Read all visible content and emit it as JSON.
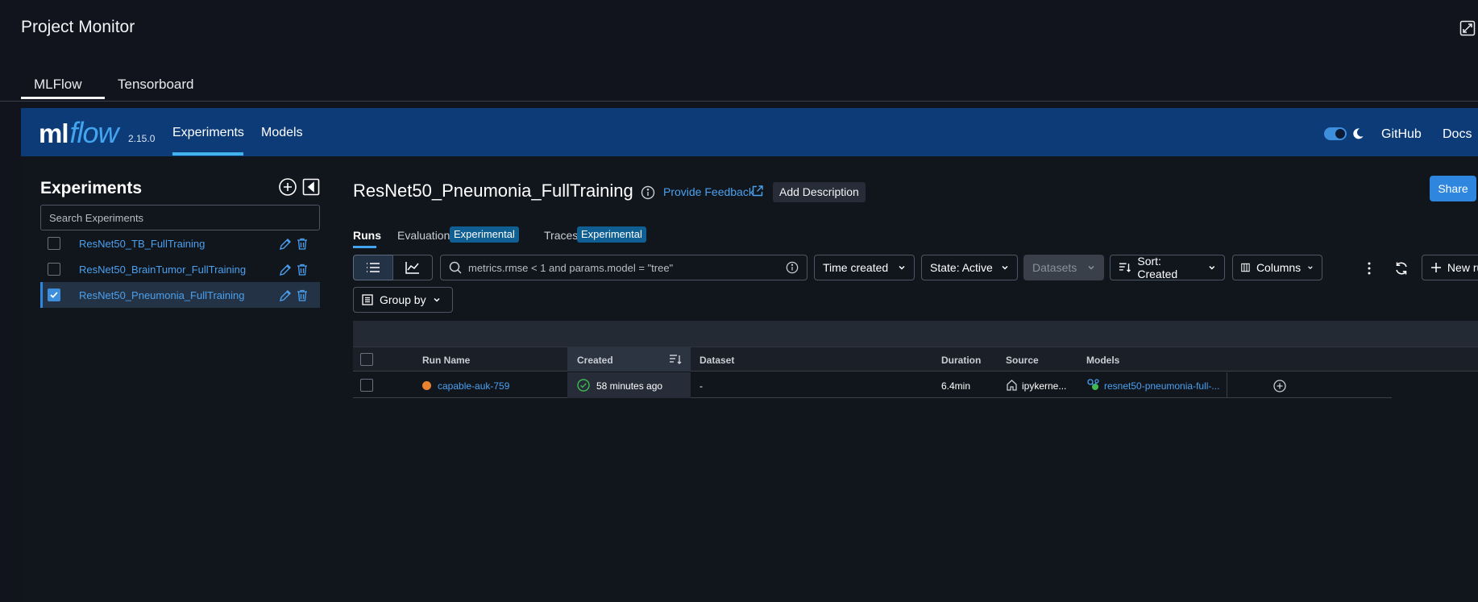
{
  "host": {
    "title": "Project Monitor",
    "tabs": [
      {
        "label": "MLFlow"
      },
      {
        "label": "Tensorboard"
      }
    ],
    "active_tab": "MLFlow"
  },
  "mlflow": {
    "logo_ml": "ml",
    "logo_flow": "flow",
    "version": "2.15.0",
    "nav": {
      "experiments": "Experiments",
      "models": "Models"
    },
    "links": {
      "github": "GitHub",
      "docs": "Docs"
    },
    "accent": "#43a5f0"
  },
  "sidebar": {
    "heading": "Experiments",
    "search_placeholder": "Search Experiments",
    "items": [
      {
        "name": "ResNet50_TB_FullTraining",
        "checked": false
      },
      {
        "name": "ResNet50_BrainTumor_FullTraining",
        "checked": false
      },
      {
        "name": "ResNet50_Pneumonia_FullTraining",
        "checked": true
      }
    ]
  },
  "main": {
    "title": "ResNet50_Pneumonia_FullTraining",
    "feedback": "Provide Feedback",
    "add_description": "Add Description",
    "share": "Share",
    "tabs": {
      "runs": "Runs",
      "evaluation": "Evaluation",
      "traces": "Traces",
      "badge": "Experimental"
    },
    "toolbar": {
      "search_placeholder": "metrics.rmse < 1 and params.model = \"tree\"",
      "time": "Time created",
      "state": "State: Active",
      "datasets": "Datasets",
      "sort": "Sort: Created",
      "columns": "Columns",
      "new_run": "New run",
      "group_by": "Group by"
    },
    "table": {
      "headers": {
        "run_name": "Run Name",
        "created": "Created",
        "dataset": "Dataset",
        "duration": "Duration",
        "source": "Source",
        "models": "Models"
      },
      "rows": [
        {
          "run_name": "capable-auk-759",
          "status_color": "#e8832f",
          "created": "58 minutes ago",
          "dataset": "-",
          "duration": "6.4min",
          "source": "ipykerne...",
          "model": "resnet50-pneumonia-full-..."
        }
      ]
    }
  }
}
